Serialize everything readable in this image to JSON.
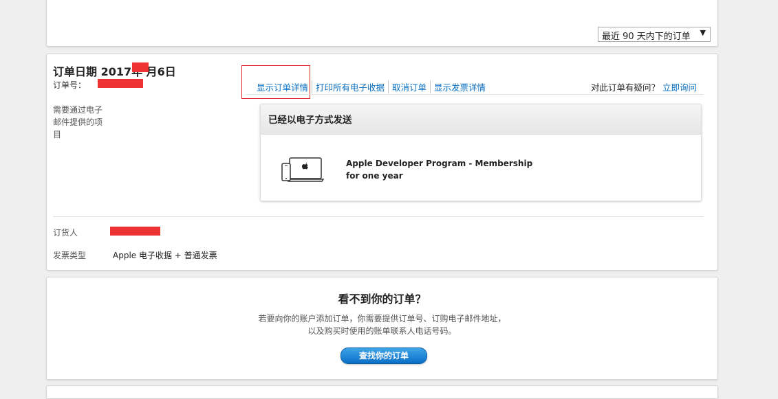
{
  "filter": {
    "selected": "最近 90 天内下的订单",
    "arrow": "▼"
  },
  "order": {
    "date_label": "订单日期 2017年 月6日",
    "number_label": "订单号：",
    "actions": [
      "显示订单详情",
      "打印所有电子收据",
      "取消订单",
      "显示发票详情"
    ],
    "inquiry_text": "对此订单有疑问？",
    "inquiry_link": "立即询问",
    "items_label": "需要通过电子邮件提供的项目",
    "shipment_header": "已经以电子方式发送",
    "product_name": "Apple Developer Program - Membership for one year",
    "orderer_label": "订货人",
    "invoice_type_label": "发票类型",
    "invoice_type_value": "Apple 电子收据 + 普通发票"
  },
  "help": {
    "title": "看不到你的订单？",
    "line1": "若要向你的账户添加订单，你需要提供订单号、订购电子邮件地址，",
    "line2": "以及购买时使用的账单联系人电话号码。",
    "button": "查找你的订单"
  },
  "colors": {
    "link": "#0a70c2",
    "redaction": "#ee3234",
    "highlight_box": "#e02020",
    "button": "#0b6fc6"
  }
}
